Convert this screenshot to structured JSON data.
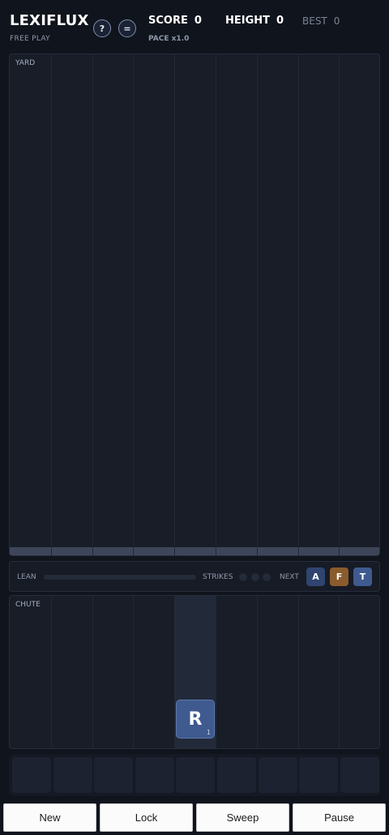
{
  "header": {
    "title": "LEXIFLUX",
    "mode": "FREE PLAY",
    "help_label": "?",
    "menu_label": "=",
    "score_label": "SCORE",
    "score_value": "0",
    "height_label": "HEIGHT",
    "height_value": "0",
    "best_label": "BEST",
    "best_value": "0",
    "pace": "PACE x1.0"
  },
  "yard": {
    "label": "YARD",
    "columns": 9
  },
  "status": {
    "lean_label": "LEAN",
    "lean_value": 0,
    "strikes_label": "STRIKES",
    "strikes_used": 0,
    "strikes_total": 3,
    "next_label": "NEXT",
    "next_tiles": [
      {
        "letter": "A",
        "color": "#2f4470"
      },
      {
        "letter": "F",
        "color": "#8a5b2c"
      },
      {
        "letter": "T",
        "color": "#3f5a8f"
      }
    ]
  },
  "chute": {
    "label": "CHUTE",
    "active_column": 5,
    "falling_tile": {
      "letter": "R",
      "points": "1",
      "column": 5,
      "color": "#3f5a8f"
    }
  },
  "tray": {
    "slots": 9
  },
  "actions": {
    "new": "New",
    "lock": "Lock",
    "sweep": "Sweep",
    "pause": "Pause"
  },
  "colors": {
    "background": "#10141c",
    "panel": "#181d28",
    "tile_blue": "#3f5a8f",
    "tile_orange": "#8a5b2c"
  }
}
